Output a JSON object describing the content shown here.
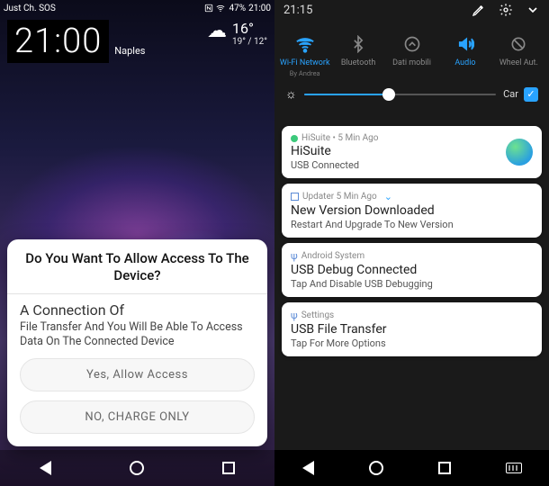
{
  "left": {
    "status": {
      "carrier": "Just Ch. SOS",
      "battery": "47%",
      "clock": "21:00"
    },
    "clock": "21:00",
    "city": "Naples",
    "weather": {
      "temp": "16°",
      "range": "19° / 12°"
    },
    "dialog": {
      "title": "Do You Want To Allow Access To The Device?",
      "subtitle": "A Connection Of",
      "desc": "File Transfer And You Will Be Able To Access Data On The Connected Device",
      "allow": "Yes, Allow Access",
      "deny": "NO, CHARGE ONLY"
    }
  },
  "right": {
    "time": "21:15",
    "toggles": {
      "wifi": {
        "label": "Wi-Fi Network",
        "sub": "By Andrea"
      },
      "bt": {
        "label": "Bluetooth"
      },
      "data": {
        "label": "Dati mobili"
      },
      "audio": {
        "label": "Audio"
      },
      "wheel": {
        "label": "Wheel Aut."
      }
    },
    "brightness": {
      "auto_label": "Car"
    },
    "notif": {
      "hisuite": {
        "meta": "HiSuite • 5 Min Ago",
        "title": "HiSuite",
        "line": "USB Connected"
      },
      "updater": {
        "meta": "Updater 5 Min Ago",
        "title": "New Version Downloaded",
        "line": "Restart And Upgrade To New Version"
      },
      "android": {
        "meta": "Android System",
        "title": "USB Debug Connected",
        "line": "Tap And Disable USB Debugging"
      },
      "settings": {
        "meta": "Settings",
        "title": "USB File Transfer",
        "line": "Tap For More Options"
      }
    }
  }
}
